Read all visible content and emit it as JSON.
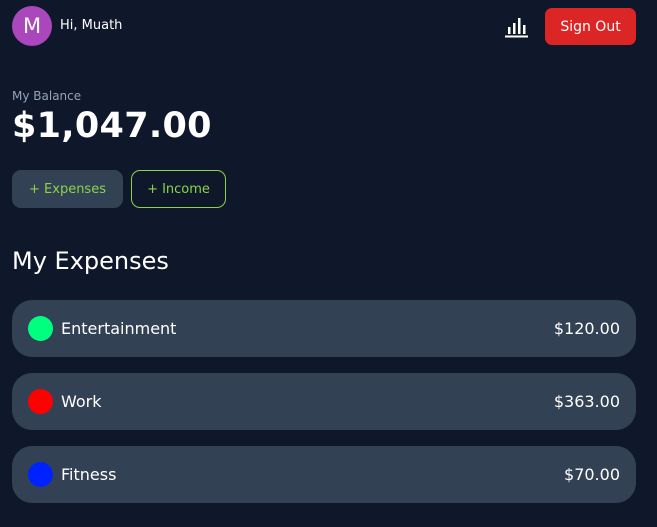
{
  "user": {
    "avatar_letter": "M",
    "avatar_color": "#ab47bc",
    "greeting": "Hi, Muath"
  },
  "header": {
    "stats_icon": "bar-chart-icon",
    "sign_out_label": "Sign Out",
    "sign_out_color": "#dc2626"
  },
  "balance": {
    "label": "My Balance",
    "amount": "$1,047.00"
  },
  "actions": {
    "add_expenses_label": "+ Expenses",
    "add_income_label": "+ Income",
    "accent_color": "#8bd34a"
  },
  "expenses": {
    "title": "My Expenses",
    "items": [
      {
        "name": "Entertainment",
        "amount": "$120.00",
        "color": "#00ff7f"
      },
      {
        "name": "Work",
        "amount": "$363.00",
        "color": "#ff0000"
      },
      {
        "name": "Fitness",
        "amount": "$70.00",
        "color": "#0022ff"
      }
    ]
  },
  "theme": {
    "background": "#0f172a",
    "card": "#334155",
    "muted_text": "#94a3b8"
  }
}
